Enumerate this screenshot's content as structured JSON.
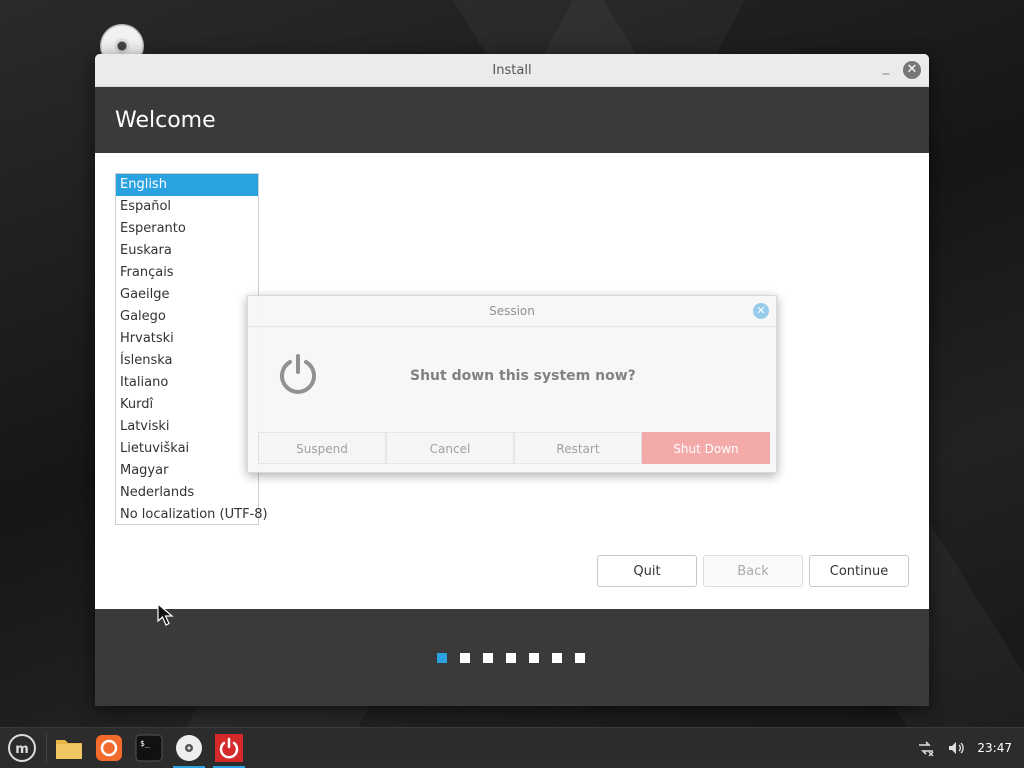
{
  "window": {
    "title": "Install"
  },
  "header": {
    "title": "Welcome"
  },
  "languages": {
    "selected": "English",
    "items": [
      "English",
      "Español",
      "Esperanto",
      "Euskara",
      "Français",
      "Gaeilge",
      "Galego",
      "Hrvatski",
      "Íslenska",
      "Italiano",
      "Kurdî",
      "Latviski",
      "Lietuviškai",
      "Magyar",
      "Nederlands",
      "No localization (UTF-8)"
    ]
  },
  "buttons": {
    "quit": "Quit",
    "back": "Back",
    "continue": "Continue"
  },
  "steps": {
    "total": 7,
    "current": 1
  },
  "session_dialog": {
    "title": "Session",
    "question": "Shut down this system now?",
    "buttons": {
      "suspend": "Suspend",
      "cancel": "Cancel",
      "restart": "Restart",
      "shutdown": "Shut Down"
    }
  },
  "taskbar": {
    "icons": [
      "mint-menu-icon",
      "folder-icon",
      "firefox-icon",
      "terminal-icon",
      "disc-installer-icon",
      "power-icon"
    ],
    "clock": "23:47"
  },
  "colors": {
    "accent": "#2aa1e0",
    "danger": "#f5a3a3",
    "header": "#3a3a3a"
  }
}
